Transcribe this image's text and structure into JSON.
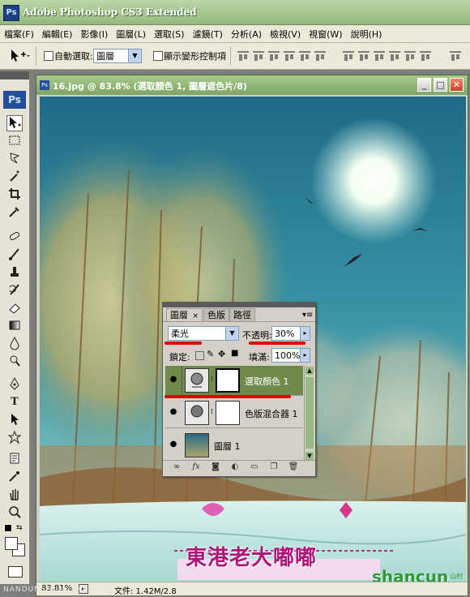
{
  "app": {
    "title": "Adobe Photoshop CS3 Extended",
    "icon": "Ps"
  },
  "menu": [
    "檔案(F)",
    "編輯(E)",
    "影像(I)",
    "圖層(L)",
    "選取(S)",
    "濾鏡(T)",
    "分析(A)",
    "檢視(V)",
    "視窗(W)",
    "說明(H)"
  ],
  "options_bar": {
    "auto_select_label": "自動選取:",
    "auto_select_value": "圖層",
    "transform_controls_label": "顯示變形控制項"
  },
  "toolbox": {
    "logo": "Ps"
  },
  "document": {
    "title": "16.jpg @ 83.8% (選取顏色 1, 圖層遮色片/8)",
    "zoom": "83.81%",
    "file_info": "文件: 1.42M/2.8",
    "watermark_left": "NANDUNSOUN.COM"
  },
  "layers_panel": {
    "tabs": [
      "圖層",
      "色版",
      "路徑"
    ],
    "blend_mode": "柔光",
    "opacity_label": "不透明:",
    "opacity_value": "30%",
    "lock_label": "鎖定:",
    "fill_label": "填滿:",
    "fill_value": "100%",
    "layers": [
      {
        "name": "選取顏色 1",
        "selected": true,
        "type": "adjustment"
      },
      {
        "name": "色版混合器 1",
        "selected": false,
        "type": "adjustment"
      },
      {
        "name": "圖層 1",
        "selected": false,
        "type": "image"
      }
    ]
  },
  "overlay": {
    "logo_text": "東港老大嘟嘟",
    "site_text": "shancun",
    "site_sub": "山村网"
  },
  "colors": {
    "titlebar": "#94b97c",
    "selected_layer": "#6f8a4b",
    "highlight": "#e00000"
  }
}
